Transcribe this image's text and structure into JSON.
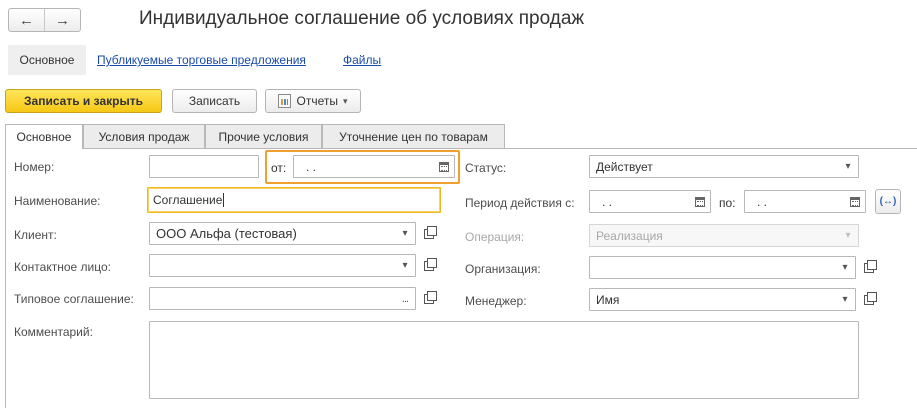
{
  "window": {
    "title": "Индивидуальное соглашение об условиях продаж",
    "nav_back_icon": "←",
    "nav_forward_icon": "→"
  },
  "form_tabs": {
    "main": "Основное",
    "links": [
      "Публикуемые торговые предложения",
      "Файлы"
    ]
  },
  "toolbar": {
    "save_close_label": "Записать и закрыть",
    "save_label": "Записать",
    "reports_label": "Отчеты",
    "caret": "▾"
  },
  "page_tabs": [
    "Основное",
    "Условия продаж",
    "Прочие условия",
    "Уточнение цен по товарам"
  ],
  "fields": {
    "number_label": "Номер:",
    "number_value": "",
    "from_label": "от:",
    "from_value": ". .",
    "name_label": "Наименование:",
    "name_value": "Соглашение",
    "client_label": "Клиент:",
    "client_value": "ООО Альфа (тестовая)",
    "contact_label": "Контактное лицо:",
    "contact_value": "",
    "typical_label": "Типовое соглашение:",
    "typical_value": "",
    "typical_select_icon": "...",
    "comment_label": "Комментарий:",
    "comment_value": "",
    "status_label": "Статус:",
    "status_value": "Действует",
    "period_label": "Период действия с:",
    "period_from_value": ". .",
    "period_to_label": "по:",
    "period_to_value": ". .",
    "period_button_icon": "(↔)",
    "operation_label": "Операция:",
    "operation_value": "Реализация",
    "organization_label": "Организация:",
    "organization_value": "",
    "manager_label": "Менеджер:",
    "manager_value": "Имя",
    "dropdown_icon": "▾"
  },
  "colors": {
    "primary_button": "#f6c816",
    "focus_orange": "#f0a030",
    "link_blue": "#1a4ba8"
  }
}
